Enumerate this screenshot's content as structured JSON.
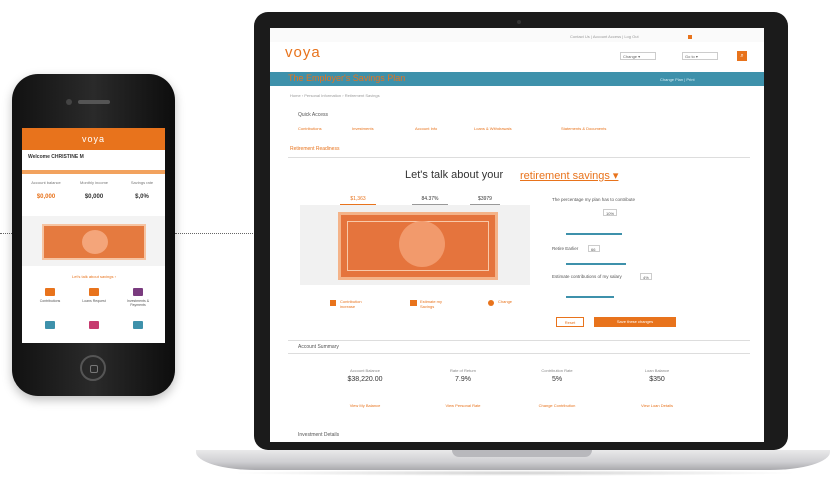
{
  "phone": {
    "brand": "voya",
    "title": "Welcome CHRISTINE M",
    "stats": [
      {
        "label": "Account balance",
        "value": "$0,000"
      },
      {
        "label": "Monthly income",
        "value": "$0,000"
      },
      {
        "label": "Savings rate",
        "value": "$,0%"
      }
    ],
    "link": "Let's talk about savings ›",
    "icons": [
      {
        "label": "Contributions",
        "color": "#e8731c"
      },
      {
        "label": "Loans Request",
        "color": "#e8731c"
      },
      {
        "label": "Investments & Payments",
        "color": "#7a3b7f"
      },
      {
        "label": "",
        "color": "#3e91ab"
      },
      {
        "label": "",
        "color": "#c63b6f"
      },
      {
        "label": "",
        "color": "#3e91ab"
      }
    ]
  },
  "site": {
    "top_nav": "Contact Us  |  Account Access  |  Log Out",
    "logo": "voya",
    "selects": [
      "Change ▾",
      "Go to ▾"
    ],
    "band_title": "The Employer's Savings Plan",
    "band_right": "Change Plan  |  Print",
    "breadcrumb": "Home  ›  Personal Information  ›  Retirement Savings",
    "quick_access": "Quick Access",
    "tabs": [
      "Contributions",
      "Investments",
      "Account Info",
      "Loans & Withdrawals",
      "Statements & Documents"
    ],
    "section_tab": "Retirement Readiness",
    "headline": "Let's talk about your",
    "headline_link": "retirement savings ▾",
    "chips": [
      "$1,363",
      "84.37%",
      "$3979"
    ],
    "form": {
      "q1": "The percentage my plan has to contribute",
      "q2": "Retire Earlier",
      "q3": "Estimate contributions of my salary",
      "val1": "10%",
      "val2": "66",
      "val3": "4%"
    },
    "actions": [
      "Contribution increase",
      "Estimate my Savings",
      "Change"
    ],
    "reset": "Reset",
    "cta": "Save these changes",
    "account_summary": "Account Summary",
    "accounts": [
      {
        "label": "Account Balance",
        "value": "$38,220.00",
        "link": "View My Balance"
      },
      {
        "label": "Rate of Return",
        "value": "7.9%",
        "link": "View Personal Rate"
      },
      {
        "label": "Contribution Rate",
        "value": "5%",
        "link": "Change Contribution"
      },
      {
        "label": "Loan Balance",
        "value": "$350",
        "link": "View Loan Details"
      }
    ],
    "investment_details": "Investment Details"
  }
}
